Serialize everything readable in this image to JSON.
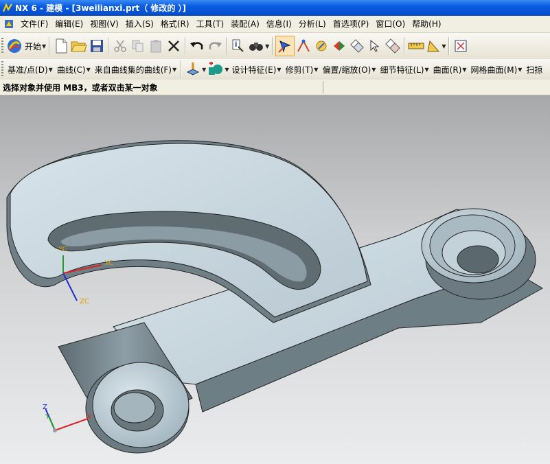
{
  "window": {
    "title": "NX 6 - 建模 - [3weilianxi.prt（ 修改的 ）]"
  },
  "menubar": {
    "items": [
      {
        "label": "文件(F)"
      },
      {
        "label": "编辑(E)"
      },
      {
        "label": "视图(V)"
      },
      {
        "label": "插入(S)"
      },
      {
        "label": "格式(R)"
      },
      {
        "label": "工具(T)"
      },
      {
        "label": "装配(A)"
      },
      {
        "label": "信息(I)"
      },
      {
        "label": "分析(L)"
      },
      {
        "label": "首选项(P)"
      },
      {
        "label": "窗口(O)"
      },
      {
        "label": "帮助(H)"
      }
    ]
  },
  "toolbar1": {
    "start_label": "开始"
  },
  "toolbar2": {
    "items": [
      {
        "label": "基准/点(D)"
      },
      {
        "label": "曲线(C)"
      },
      {
        "label": "来自曲线集的曲线(F)"
      },
      {
        "label": "设计特征(E)"
      },
      {
        "label": "修剪(T)"
      },
      {
        "label": "偏置/缩放(O)"
      },
      {
        "label": "细节特征(L)"
      },
      {
        "label": "曲面(R)"
      },
      {
        "label": "网格曲面(M)"
      },
      {
        "label": "扫掠"
      }
    ]
  },
  "status": {
    "prompt": "选择对象并使用 MB3，或者双击某一对象"
  },
  "viewport": {
    "wcs_labels": {
      "yc": "YC",
      "xc": "XC",
      "zc": "ZC"
    },
    "abs_labels": {
      "z": "Z",
      "y": "Y",
      "x": "X"
    },
    "colors": {
      "part_face": "#c9d6df",
      "part_side": "#6b7a80",
      "edge": "#1a1a1a",
      "axis_x": "#e02020",
      "axis_y": "#20a020",
      "axis_z": "#2030d0"
    }
  }
}
